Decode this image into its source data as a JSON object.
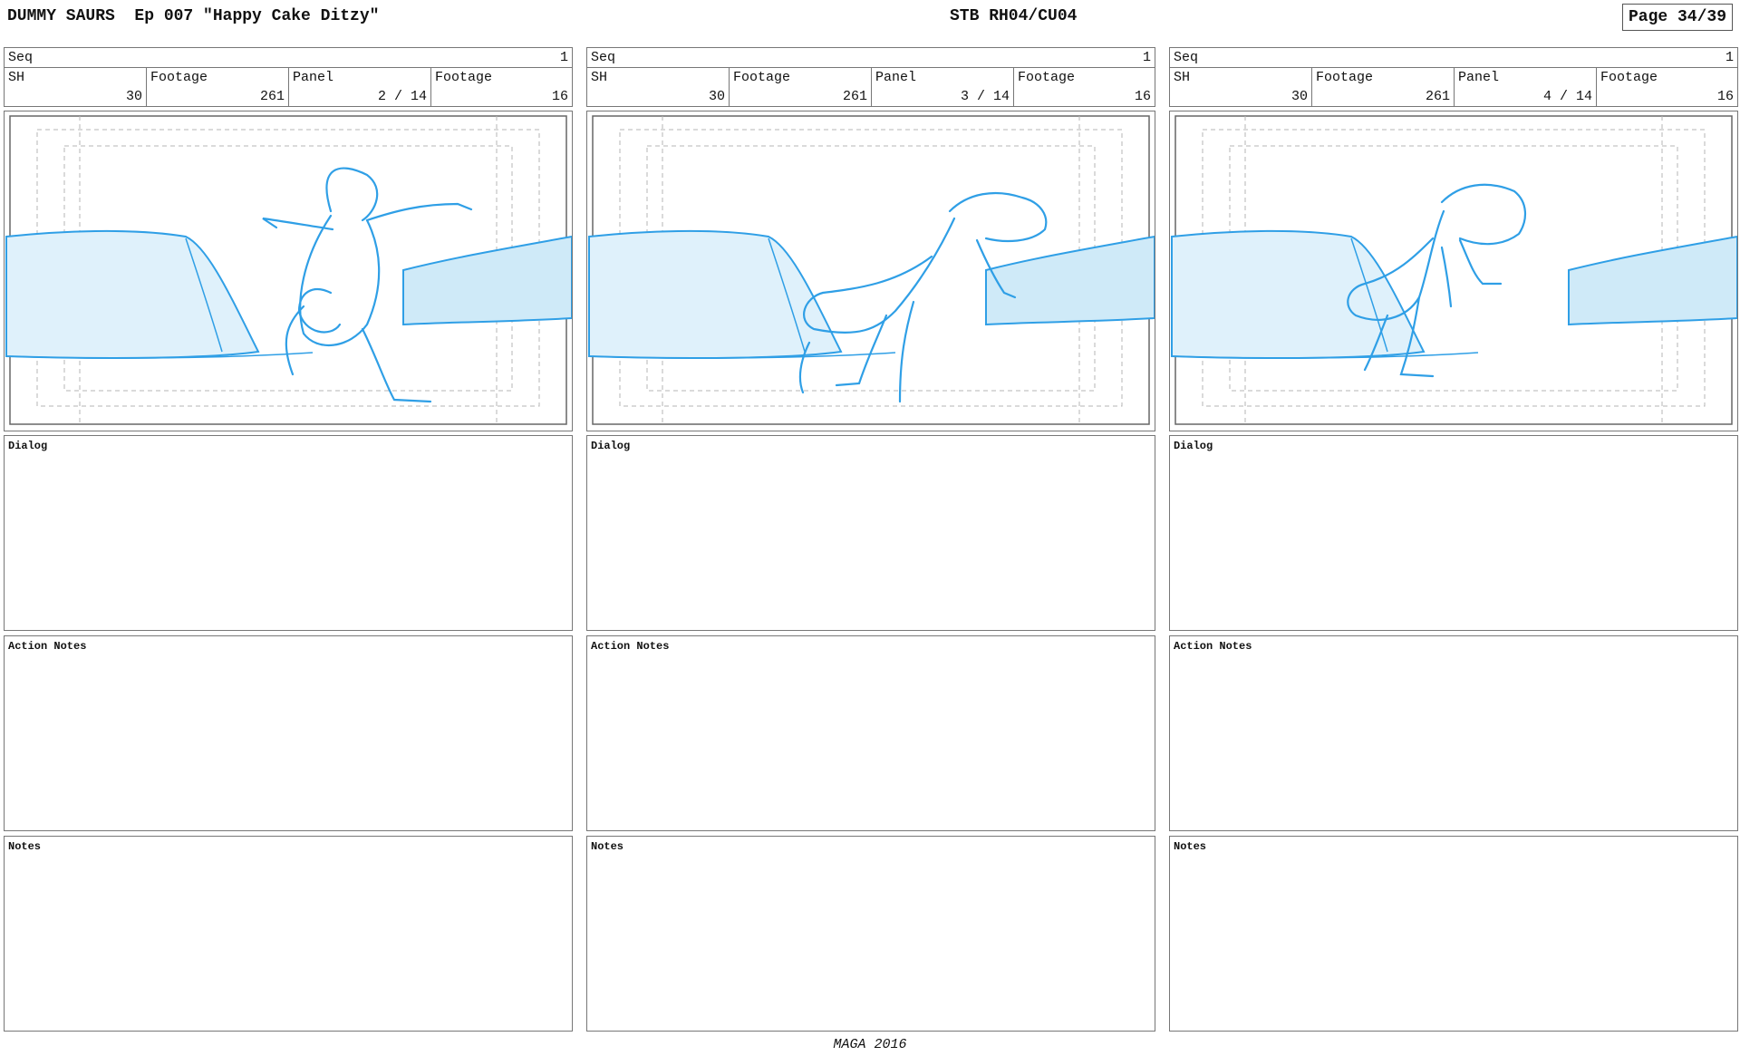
{
  "header": {
    "show_title": "DUMMY SAURS  Ep 007 \"Happy Cake Ditzy\"",
    "stb_title": "STB RH04/CU04",
    "page": "Page 34/39"
  },
  "labels": {
    "seq": "Seq",
    "sh": "SH",
    "footage": "Footage",
    "panel": "Panel",
    "dialog": "Dialog",
    "action_notes": "Action Notes",
    "notes": "Notes"
  },
  "panels": [
    {
      "seq": "1",
      "sh": "30",
      "footage": "261",
      "panel": "2 / 14",
      "panel_footage": "16"
    },
    {
      "seq": "1",
      "sh": "30",
      "footage": "261",
      "panel": "3 / 14",
      "panel_footage": "16"
    },
    {
      "seq": "1",
      "sh": "30",
      "footage": "261",
      "panel": "4 / 14",
      "panel_footage": "16"
    }
  ],
  "colors": {
    "sketch": "#2f9fe6",
    "sketch_fill": "#dff1fb",
    "guide": "#b5b5b5"
  },
  "footer": {
    "credit": "MAGA 2016"
  }
}
